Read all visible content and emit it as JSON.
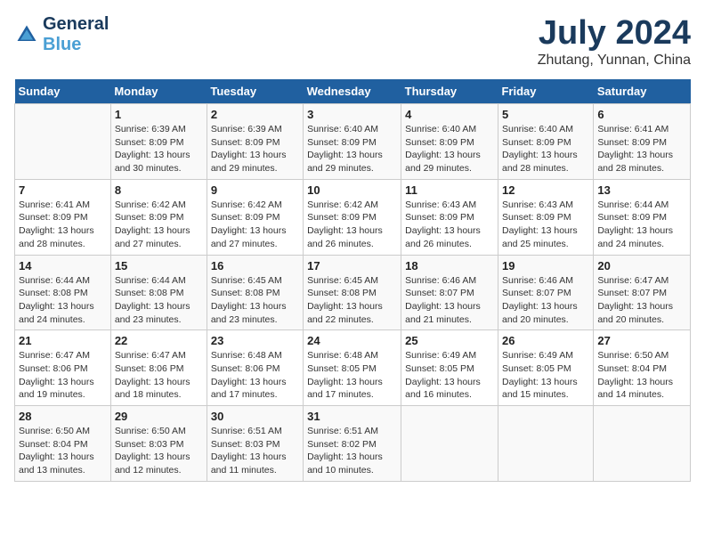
{
  "header": {
    "logo_line1": "General",
    "logo_line2": "Blue",
    "month_year": "July 2024",
    "location": "Zhutang, Yunnan, China"
  },
  "days_of_week": [
    "Sunday",
    "Monday",
    "Tuesday",
    "Wednesday",
    "Thursday",
    "Friday",
    "Saturday"
  ],
  "weeks": [
    [
      {
        "day": "",
        "sunrise": "",
        "sunset": "",
        "daylight": ""
      },
      {
        "day": "1",
        "sunrise": "Sunrise: 6:39 AM",
        "sunset": "Sunset: 8:09 PM",
        "daylight": "Daylight: 13 hours and 30 minutes."
      },
      {
        "day": "2",
        "sunrise": "Sunrise: 6:39 AM",
        "sunset": "Sunset: 8:09 PM",
        "daylight": "Daylight: 13 hours and 29 minutes."
      },
      {
        "day": "3",
        "sunrise": "Sunrise: 6:40 AM",
        "sunset": "Sunset: 8:09 PM",
        "daylight": "Daylight: 13 hours and 29 minutes."
      },
      {
        "day": "4",
        "sunrise": "Sunrise: 6:40 AM",
        "sunset": "Sunset: 8:09 PM",
        "daylight": "Daylight: 13 hours and 29 minutes."
      },
      {
        "day": "5",
        "sunrise": "Sunrise: 6:40 AM",
        "sunset": "Sunset: 8:09 PM",
        "daylight": "Daylight: 13 hours and 28 minutes."
      },
      {
        "day": "6",
        "sunrise": "Sunrise: 6:41 AM",
        "sunset": "Sunset: 8:09 PM",
        "daylight": "Daylight: 13 hours and 28 minutes."
      }
    ],
    [
      {
        "day": "7",
        "sunrise": "Sunrise: 6:41 AM",
        "sunset": "Sunset: 8:09 PM",
        "daylight": "Daylight: 13 hours and 28 minutes."
      },
      {
        "day": "8",
        "sunrise": "Sunrise: 6:42 AM",
        "sunset": "Sunset: 8:09 PM",
        "daylight": "Daylight: 13 hours and 27 minutes."
      },
      {
        "day": "9",
        "sunrise": "Sunrise: 6:42 AM",
        "sunset": "Sunset: 8:09 PM",
        "daylight": "Daylight: 13 hours and 27 minutes."
      },
      {
        "day": "10",
        "sunrise": "Sunrise: 6:42 AM",
        "sunset": "Sunset: 8:09 PM",
        "daylight": "Daylight: 13 hours and 26 minutes."
      },
      {
        "day": "11",
        "sunrise": "Sunrise: 6:43 AM",
        "sunset": "Sunset: 8:09 PM",
        "daylight": "Daylight: 13 hours and 26 minutes."
      },
      {
        "day": "12",
        "sunrise": "Sunrise: 6:43 AM",
        "sunset": "Sunset: 8:09 PM",
        "daylight": "Daylight: 13 hours and 25 minutes."
      },
      {
        "day": "13",
        "sunrise": "Sunrise: 6:44 AM",
        "sunset": "Sunset: 8:09 PM",
        "daylight": "Daylight: 13 hours and 24 minutes."
      }
    ],
    [
      {
        "day": "14",
        "sunrise": "Sunrise: 6:44 AM",
        "sunset": "Sunset: 8:08 PM",
        "daylight": "Daylight: 13 hours and 24 minutes."
      },
      {
        "day": "15",
        "sunrise": "Sunrise: 6:44 AM",
        "sunset": "Sunset: 8:08 PM",
        "daylight": "Daylight: 13 hours and 23 minutes."
      },
      {
        "day": "16",
        "sunrise": "Sunrise: 6:45 AM",
        "sunset": "Sunset: 8:08 PM",
        "daylight": "Daylight: 13 hours and 23 minutes."
      },
      {
        "day": "17",
        "sunrise": "Sunrise: 6:45 AM",
        "sunset": "Sunset: 8:08 PM",
        "daylight": "Daylight: 13 hours and 22 minutes."
      },
      {
        "day": "18",
        "sunrise": "Sunrise: 6:46 AM",
        "sunset": "Sunset: 8:07 PM",
        "daylight": "Daylight: 13 hours and 21 minutes."
      },
      {
        "day": "19",
        "sunrise": "Sunrise: 6:46 AM",
        "sunset": "Sunset: 8:07 PM",
        "daylight": "Daylight: 13 hours and 20 minutes."
      },
      {
        "day": "20",
        "sunrise": "Sunrise: 6:47 AM",
        "sunset": "Sunset: 8:07 PM",
        "daylight": "Daylight: 13 hours and 20 minutes."
      }
    ],
    [
      {
        "day": "21",
        "sunrise": "Sunrise: 6:47 AM",
        "sunset": "Sunset: 8:06 PM",
        "daylight": "Daylight: 13 hours and 19 minutes."
      },
      {
        "day": "22",
        "sunrise": "Sunrise: 6:47 AM",
        "sunset": "Sunset: 8:06 PM",
        "daylight": "Daylight: 13 hours and 18 minutes."
      },
      {
        "day": "23",
        "sunrise": "Sunrise: 6:48 AM",
        "sunset": "Sunset: 8:06 PM",
        "daylight": "Daylight: 13 hours and 17 minutes."
      },
      {
        "day": "24",
        "sunrise": "Sunrise: 6:48 AM",
        "sunset": "Sunset: 8:05 PM",
        "daylight": "Daylight: 13 hours and 17 minutes."
      },
      {
        "day": "25",
        "sunrise": "Sunrise: 6:49 AM",
        "sunset": "Sunset: 8:05 PM",
        "daylight": "Daylight: 13 hours and 16 minutes."
      },
      {
        "day": "26",
        "sunrise": "Sunrise: 6:49 AM",
        "sunset": "Sunset: 8:05 PM",
        "daylight": "Daylight: 13 hours and 15 minutes."
      },
      {
        "day": "27",
        "sunrise": "Sunrise: 6:50 AM",
        "sunset": "Sunset: 8:04 PM",
        "daylight": "Daylight: 13 hours and 14 minutes."
      }
    ],
    [
      {
        "day": "28",
        "sunrise": "Sunrise: 6:50 AM",
        "sunset": "Sunset: 8:04 PM",
        "daylight": "Daylight: 13 hours and 13 minutes."
      },
      {
        "day": "29",
        "sunrise": "Sunrise: 6:50 AM",
        "sunset": "Sunset: 8:03 PM",
        "daylight": "Daylight: 13 hours and 12 minutes."
      },
      {
        "day": "30",
        "sunrise": "Sunrise: 6:51 AM",
        "sunset": "Sunset: 8:03 PM",
        "daylight": "Daylight: 13 hours and 11 minutes."
      },
      {
        "day": "31",
        "sunrise": "Sunrise: 6:51 AM",
        "sunset": "Sunset: 8:02 PM",
        "daylight": "Daylight: 13 hours and 10 minutes."
      },
      {
        "day": "",
        "sunrise": "",
        "sunset": "",
        "daylight": ""
      },
      {
        "day": "",
        "sunrise": "",
        "sunset": "",
        "daylight": ""
      },
      {
        "day": "",
        "sunrise": "",
        "sunset": "",
        "daylight": ""
      }
    ]
  ]
}
